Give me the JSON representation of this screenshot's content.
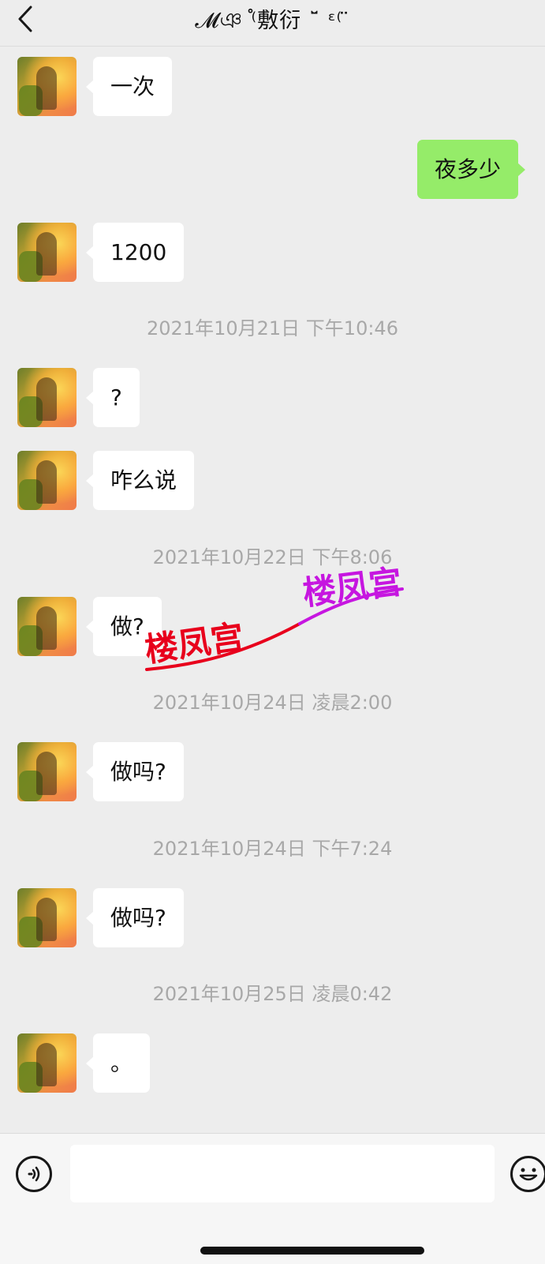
{
  "header": {
    "title": "𝓜ঞ ֯⁽敷衍 ˘̈ ᵋ⁽ ̈",
    "back_icon": "chevron-left-icon"
  },
  "messages": [
    {
      "type": "msg",
      "side": "left",
      "text": "一次"
    },
    {
      "type": "msg",
      "side": "right",
      "text": "夜多少"
    },
    {
      "type": "msg",
      "side": "left",
      "text": "1200"
    },
    {
      "type": "time",
      "text": "2021年10月21日 下午10:46"
    },
    {
      "type": "msg",
      "side": "left",
      "text": "?"
    },
    {
      "type": "msg",
      "side": "left",
      "text": "咋么说"
    },
    {
      "type": "time",
      "text": "2021年10月22日 下午8:06"
    },
    {
      "type": "msg",
      "side": "left",
      "text": "做?"
    },
    {
      "type": "time",
      "text": "2021年10月24日 凌晨2:00"
    },
    {
      "type": "msg",
      "side": "left",
      "text": "做吗?"
    },
    {
      "type": "time",
      "text": "2021年10月24日 下午7:24"
    },
    {
      "type": "msg",
      "side": "left",
      "text": "做吗?"
    },
    {
      "type": "time",
      "text": "2021年10月25日 凌晨0:42"
    },
    {
      "type": "msg",
      "side": "left",
      "text": "。"
    }
  ],
  "watermark": {
    "text_1": "楼凤宫",
    "text_2": "楼凤宫",
    "color_1": "#e8001c",
    "color_2": "#c616e0"
  },
  "input_bar": {
    "text_value": "",
    "voice_icon": "voice-icon",
    "emoji_icon": "emoji-icon"
  },
  "colors": {
    "background": "#ededed",
    "sent_bubble": "#95ec69",
    "received_bubble": "#ffffff",
    "timestamp": "#a8a8a8"
  }
}
